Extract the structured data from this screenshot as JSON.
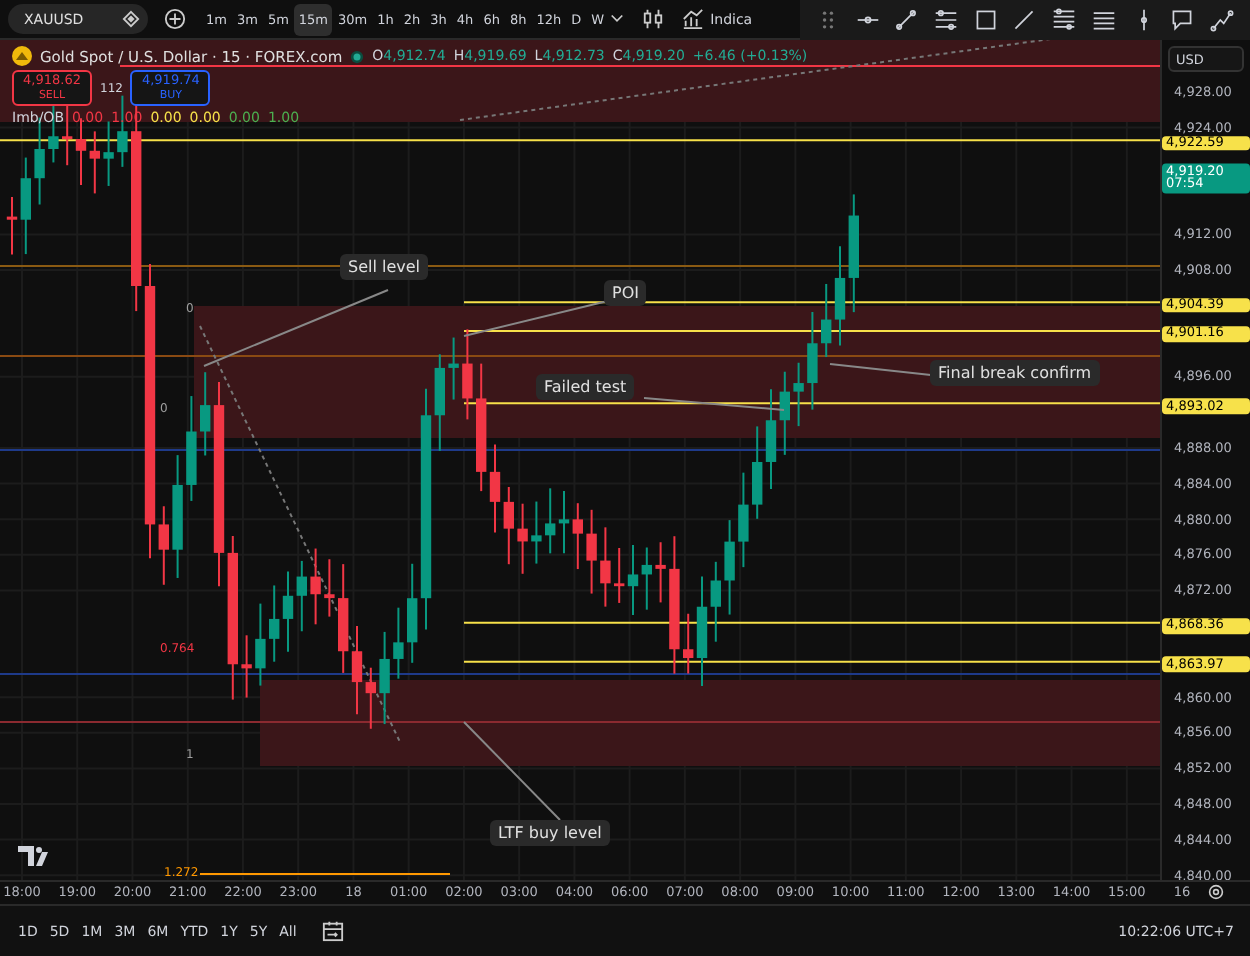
{
  "toolbar": {
    "symbol": "XAUUSD",
    "intervals": [
      {
        "label": "1m",
        "selected": false
      },
      {
        "label": "3m",
        "selected": false
      },
      {
        "label": "5m",
        "selected": false
      },
      {
        "label": "15m",
        "selected": true
      },
      {
        "label": "30m",
        "selected": false
      },
      {
        "label": "1h",
        "selected": false
      },
      {
        "label": "2h",
        "selected": false
      },
      {
        "label": "3h",
        "selected": false
      },
      {
        "label": "4h",
        "selected": false
      },
      {
        "label": "6h",
        "selected": false
      },
      {
        "label": "8h",
        "selected": false
      },
      {
        "label": "12h",
        "selected": false
      },
      {
        "label": "D",
        "selected": false
      },
      {
        "label": "W",
        "selected": false
      }
    ],
    "indicators_label": "Indica"
  },
  "legend": {
    "title": "Gold Spot / U.S. Dollar · 15 · FOREX.com",
    "ohlc": [
      {
        "key": "O",
        "value": "4,912.74"
      },
      {
        "key": "H",
        "value": "4,919.69"
      },
      {
        "key": "L",
        "value": "4,912.73"
      },
      {
        "key": "C",
        "value": "4,919.20"
      }
    ],
    "change": "+6.46 (+0.13%)",
    "sell": {
      "price": "4,918.62",
      "label": "SELL"
    },
    "spread": "112",
    "buy": {
      "price": "4,919.74",
      "label": "BUY"
    },
    "indicator": {
      "name": "Imb/OB",
      "values": [
        {
          "text": "0.00",
          "color": "#f23645"
        },
        {
          "text": "1.00",
          "color": "#f23645"
        },
        {
          "text": "0.00",
          "color": "#f7e14a"
        },
        {
          "text": "0.00",
          "color": "#f7e14a"
        },
        {
          "text": "0.00",
          "color": "#4caf50"
        },
        {
          "text": "1.00",
          "color": "#4caf50"
        }
      ]
    }
  },
  "annotations": [
    {
      "text": "Sell level"
    },
    {
      "text": "POI"
    },
    {
      "text": "Failed test"
    },
    {
      "text": "Final break confirm"
    },
    {
      "text": "LTF buy level"
    }
  ],
  "fib_labels": [
    {
      "text": "0",
      "color": "#9e9e9e"
    },
    {
      "text": "0",
      "color": "#9e9e9e"
    },
    {
      "text": "0.764",
      "color": "#f23645"
    },
    {
      "text": "1",
      "color": "#9e9e9e"
    },
    {
      "text": "1.272",
      "color": "#ff9800"
    }
  ],
  "price_axis": {
    "currency": "USD",
    "ticks": [
      "4,928.00",
      "4,924.00",
      "4,912.00",
      "4,908.00",
      "4,896.00",
      "4,888.00",
      "4,884.00",
      "4,880.00",
      "4,876.00",
      "4,872.00",
      "4,860.00",
      "4,856.00",
      "4,852.00",
      "4,848.00",
      "4,844.00",
      "4,840.00"
    ],
    "badges": [
      {
        "kind": "level",
        "text": "4,922.59"
      },
      {
        "kind": "current",
        "text": "4,919.20",
        "countdown": "07:54"
      },
      {
        "kind": "level",
        "text": "4,904.39"
      },
      {
        "kind": "level",
        "text": "4,901.16"
      },
      {
        "kind": "level",
        "text": "4,893.02"
      },
      {
        "kind": "level",
        "text": "4,868.36"
      },
      {
        "kind": "level",
        "text": "4,863.97"
      }
    ]
  },
  "time_axis": {
    "labels": [
      "18:00",
      "19:00",
      "20:00",
      "21:00",
      "22:00",
      "23:00",
      "18",
      "01:00",
      "02:00",
      "03:00",
      "04:00",
      "06:00",
      "07:00",
      "08:00",
      "09:00",
      "10:00",
      "11:00",
      "12:00",
      "13:00",
      "14:00",
      "15:00",
      "16"
    ]
  },
  "range_bar": {
    "ranges": [
      "1D",
      "5D",
      "1M",
      "3M",
      "6M",
      "YTD",
      "1Y",
      "5Y",
      "All"
    ],
    "clock": "10:22:06 UTC+7"
  }
}
